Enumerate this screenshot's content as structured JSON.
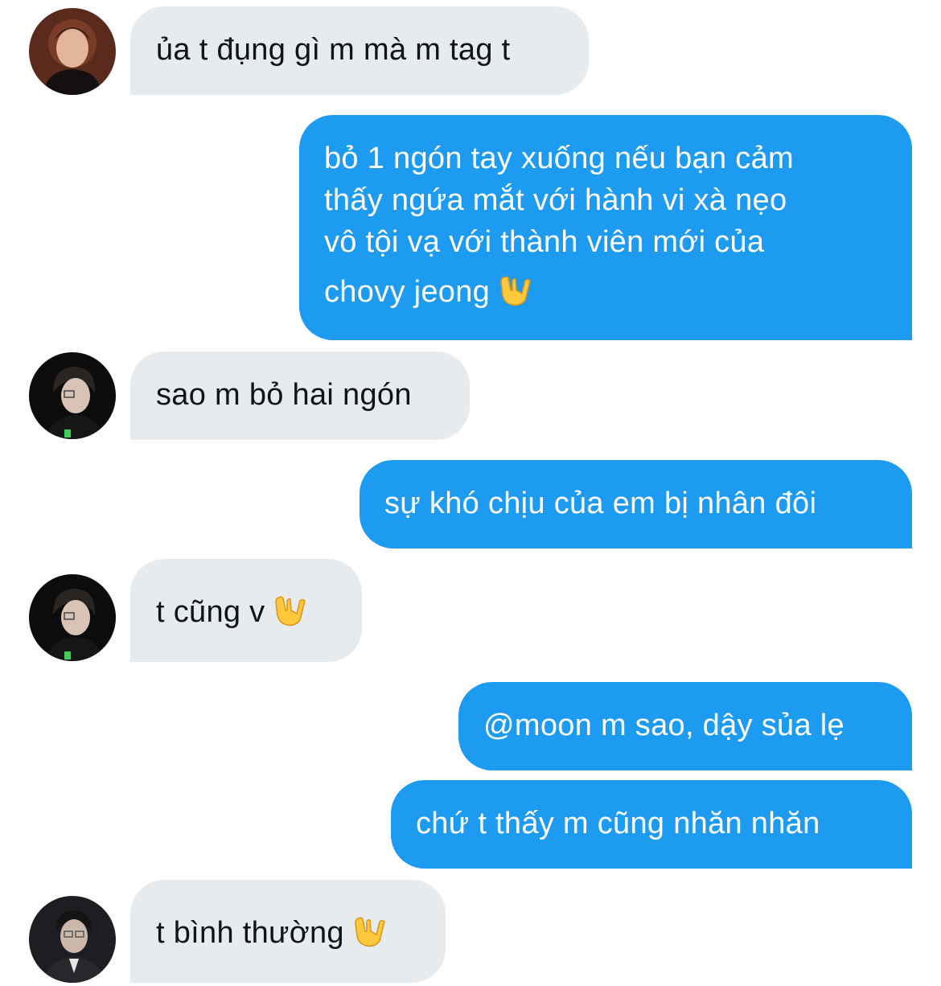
{
  "messages": [
    {
      "side": "in",
      "avatar": "avatar-user-1",
      "text": "ủa t đụng gì m mà m tag t",
      "emoji": null
    },
    {
      "side": "out",
      "lines": [
        "bỏ 1 ngón tay xuống nếu bạn cảm",
        "thấy ngứa mắt với hành vi xà nẹo",
        "vô tội vạ với thành viên mới của",
        "chovy jeong"
      ],
      "emoji": "sign-of-the-horns-emoji"
    },
    {
      "side": "in",
      "avatar": "avatar-user-2",
      "text": "sao m bỏ hai ngón",
      "emoji": null
    },
    {
      "side": "out",
      "text": "sự khó chịu của em bị nhân đôi",
      "emoji": null
    },
    {
      "side": "in",
      "avatar": "avatar-user-2",
      "text": "t cũng v",
      "emoji": "sign-of-the-horns-emoji"
    },
    {
      "side": "out",
      "text": "@moon m sao, dậy sủa lẹ",
      "emoji": null
    },
    {
      "side": "out",
      "text": "chứ t thấy m cũng nhăn nhăn",
      "emoji": null
    },
    {
      "side": "in",
      "avatar": "avatar-user-3",
      "text": "t bình thường",
      "emoji": "sign-of-the-horns-emoji"
    }
  ],
  "colors": {
    "incoming_bubble": "#e8ebee",
    "incoming_text": "#0f1419",
    "outgoing_bubble": "#1d9bf0",
    "outgoing_text": "#ffffff"
  }
}
